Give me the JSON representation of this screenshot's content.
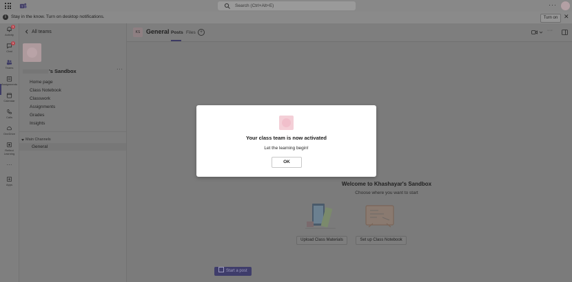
{
  "topbar": {
    "search_placeholder": "Search (Ctrl+Alt+E)",
    "more_label": "···"
  },
  "banner": {
    "message": "Stay in the know. Turn on desktop notifications.",
    "turn_on_label": "Turn on",
    "close_label": "✕"
  },
  "rail": {
    "items": [
      {
        "label": "Activity",
        "icon": "bell-icon",
        "badge": "1"
      },
      {
        "label": "Chat",
        "icon": "chat-icon",
        "badge": "1"
      },
      {
        "label": "Teams",
        "icon": "teams-icon",
        "badge": ""
      },
      {
        "label": "Assignments",
        "icon": "assignments-icon",
        "badge": ""
      },
      {
        "label": "Calendar",
        "icon": "calendar-icon",
        "badge": ""
      },
      {
        "label": "Calls",
        "icon": "phone-icon",
        "badge": ""
      },
      {
        "label": "OneDrive",
        "icon": "cloud-icon",
        "badge": ""
      },
      {
        "label": "Reflect Learning",
        "icon": "learning-icon",
        "badge": ""
      },
      {
        "label": "···",
        "icon": "more-icon",
        "badge": ""
      },
      {
        "label": "Apps",
        "icon": "apps-icon",
        "badge": ""
      }
    ]
  },
  "panel": {
    "all_teams_label": "All teams",
    "team_name_suffix": "'s Sandbox",
    "team_more": "···",
    "nav": [
      "Home page",
      "Class Notebook",
      "Classwork",
      "Assignments",
      "Grades",
      "Insights"
    ],
    "channels_heading": "Main Channels",
    "channel_general": "General"
  },
  "main": {
    "channel_avatar_text": "KS",
    "channel_title": "General",
    "tabs": {
      "posts": "Posts",
      "files": "Files",
      "add": "+"
    },
    "welcome_title": "Welcome to Khashayar's Sandbox",
    "welcome_subtitle": "Choose where you want to start",
    "upload_label": "Upload Class Materials",
    "notebook_label": "Set up Class Notebook",
    "start_post_label": "Start a post"
  },
  "modal": {
    "title": "Your class team is now activated",
    "subtitle": "Let the learning begin!",
    "ok_label": "OK"
  },
  "colors": {
    "accent": "#3f3d6b",
    "badge": "#b3434b",
    "overlay": "#7b7b7b"
  }
}
